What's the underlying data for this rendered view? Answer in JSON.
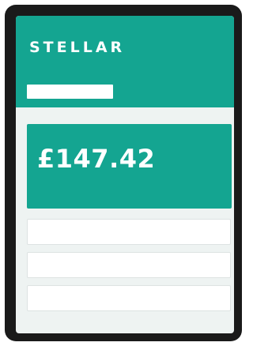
{
  "app": {
    "brand": "STELLAR"
  },
  "balance": {
    "amount": "£147.42"
  },
  "list": {
    "items": [
      "",
      "",
      ""
    ]
  },
  "colors": {
    "accent": "#14a591",
    "device_frame": "#1a1a1a",
    "screen_bg": "#eef3f2",
    "card_bg": "#ffffff"
  }
}
